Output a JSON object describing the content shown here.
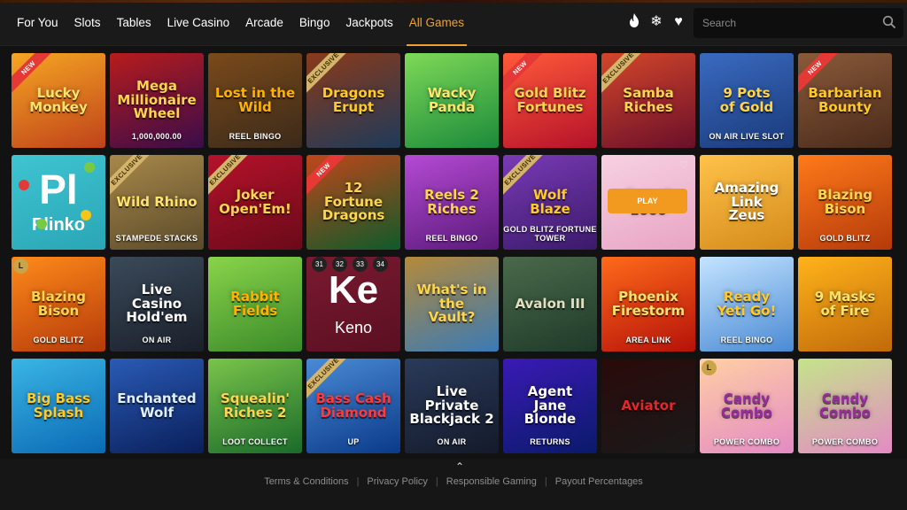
{
  "nav": {
    "items": [
      {
        "label": "For You"
      },
      {
        "label": "Slots"
      },
      {
        "label": "Tables"
      },
      {
        "label": "Live Casino"
      },
      {
        "label": "Arcade"
      },
      {
        "label": "Bingo"
      },
      {
        "label": "Jackpots"
      },
      {
        "label": "All Games",
        "active": true
      }
    ],
    "icons": [
      "fire-icon",
      "snowflake-icon",
      "heart-icon"
    ]
  },
  "search": {
    "placeholder": "Search",
    "value": ""
  },
  "colors": {
    "accent": "#f0a030",
    "background": "#121212",
    "new_badge": "#e53935",
    "exclusive_badge": "#d4b46a"
  },
  "games": [
    {
      "title": "Lucky\nMonkey",
      "badge": "NEW",
      "bg": "#c0421a",
      "bg2": "#f5a623",
      "fg": "#ffe36b"
    },
    {
      "title": "Mega\nMillionaire\nWheel",
      "sub": "1,000,000.00",
      "bg": "#3a0c4a",
      "bg2": "#b71c1c",
      "fg": "#ffd54f"
    },
    {
      "title": "Lost in the\nWild",
      "sub": "REEL BINGO",
      "bg": "#3b2a1a",
      "bg2": "#7a4a1a",
      "fg": "#ffb300"
    },
    {
      "title": "Dragons\nErupt",
      "badge": "EXCLUSIVE",
      "bg": "#1e3a5a",
      "bg2": "#8a3a1a",
      "fg": "#ffca28"
    },
    {
      "title": "Wacky\nPanda",
      "bg": "#1b8a3a",
      "bg2": "#7ed957",
      "fg": "#ffe66b"
    },
    {
      "title": "Gold Blitz\nFortunes",
      "badge": "NEW",
      "bg": "#b5122a",
      "bg2": "#ff5a3a",
      "fg": "#ffd54f"
    },
    {
      "title": "Samba\nRiches",
      "badge": "EXCLUSIVE",
      "bg": "#6a0f2a",
      "bg2": "#d4462a",
      "fg": "#ffd54f"
    },
    {
      "title": "9 Pots\nof Gold",
      "sub": "ON AIR LIVE SLOT",
      "bg": "#1a3a7a",
      "bg2": "#3a6ac0",
      "fg": "#ffd54f"
    },
    {
      "title": "Barbarian\nBounty",
      "badge": "NEW",
      "bg": "#4a2a1a",
      "bg2": "#8a5a3a",
      "fg": "#ffca28"
    },
    {
      "title": "",
      "kind": "plinko",
      "big": "Pl",
      "small": "Plinko",
      "bg": "#2aa6b5",
      "bg2": "#3fc4d2",
      "fg": "#ffffff"
    },
    {
      "title": "Wild Rhino",
      "sub": "STAMPEDE STACKS",
      "badge": "EXCLUSIVE",
      "bg": "#5a4a2a",
      "bg2": "#a8884a",
      "fg": "#ffe36b"
    },
    {
      "title": "Joker\nOpen'Em!",
      "badge": "EXCLUSIVE",
      "bg": "#6a0a1a",
      "bg2": "#b5122a",
      "fg": "#ffd54f"
    },
    {
      "title": "12\nFortune\nDragons",
      "badge": "NEW",
      "bg": "#0f5a2a",
      "bg2": "#c0461a",
      "fg": "#ffd54f"
    },
    {
      "title": "Reels 2\nRiches",
      "sub": "REEL BINGO",
      "bg": "#5a1a7a",
      "bg2": "#b54ad4",
      "fg": "#ffd54f"
    },
    {
      "title": "Wolf\nBlaze",
      "sub": "GOLD BLITZ FORTUNE TOWER",
      "badge": "EXCLUSIVE",
      "bg": "#3a1a6a",
      "bg2": "#7a3ab5",
      "fg": "#ffca28"
    },
    {
      "title": "Sweet\n1000",
      "kind": "play",
      "play": "PLAY",
      "bg": "#e8a4c4",
      "bg2": "#f7d1e2",
      "fg": "#ffe36b"
    },
    {
      "title": "Amazing Link\nZeus",
      "bg": "#d48a1a",
      "bg2": "#ffc24a",
      "fg": "#ffffff"
    },
    {
      "title": "Blazing\nBison",
      "sub": "GOLD BLITZ",
      "bg": "#b53a0a",
      "bg2": "#ff7a1a",
      "fg": "#ffd54f"
    },
    {
      "title": "Blazing\nBison",
      "sub": "GOLD BLITZ",
      "emblem": "L",
      "bg": "#b53a0a",
      "bg2": "#ff8a1a",
      "fg": "#ffd54f"
    },
    {
      "title": "Live Casino\nHold'em",
      "sub": "ON AIR",
      "bg": "#1a1f2a",
      "bg2": "#3a4a5a",
      "fg": "#ffffff"
    },
    {
      "title": "Rabbit\nFields",
      "bg": "#3a8a2a",
      "bg2": "#8ad44a",
      "fg": "#ffb300"
    },
    {
      "title": "",
      "kind": "keno",
      "big": "Ke",
      "small": "Keno",
      "numbers": [
        "31",
        "32",
        "33",
        "34"
      ],
      "bg": "#5a0f22",
      "bg2": "#7a1a30",
      "fg": "#ffffff"
    },
    {
      "title": "What's in the\nVault?",
      "bg": "#3a7ab5",
      "bg2": "#b58a3a",
      "fg": "#ffd54f"
    },
    {
      "title": "Avalon III",
      "bg": "#1f3a2a",
      "bg2": "#4a6a4a",
      "fg": "#e0e0c0"
    },
    {
      "title": "Phoenix\nFirestorm",
      "sub": "AREA LINK",
      "bg": "#b5120a",
      "bg2": "#ff6a1a",
      "fg": "#ffe36b"
    },
    {
      "title": "Ready\nYeti Go!",
      "sub": "REEL BINGO",
      "bg": "#4a8ad4",
      "bg2": "#c4e4ff",
      "fg": "#ffca28"
    },
    {
      "title": "9 Masks\nof Fire",
      "bg": "#c06a0a",
      "bg2": "#ffb31a",
      "fg": "#ffe36b"
    },
    {
      "title": "Big Bass\nSplash",
      "bg": "#0a6ab5",
      "bg2": "#3ab5e4",
      "fg": "#ffca28"
    },
    {
      "title": "Enchanted\nWolf",
      "bg": "#0a1f5a",
      "bg2": "#2a5ab5",
      "fg": "#e0f0ff"
    },
    {
      "title": "Squealin'\nRiches 2",
      "sub": "LOOT COLLECT",
      "bg": "#1a6a2a",
      "bg2": "#7ac44a",
      "fg": "#ffd54f"
    },
    {
      "title": "Bass Cash\nDiamond",
      "sub": "UP",
      "badge": "EXCLUSIVE",
      "bg": "#0a3a8a",
      "bg2": "#4a8ad4",
      "fg": "#ff3a3a"
    },
    {
      "title": "Live Private\nBlackjack 2",
      "sub": "ON AIR",
      "bg": "#141a2a",
      "bg2": "#2a3a5a",
      "fg": "#ffffff"
    },
    {
      "title": "Agent\nJane\nBlonde",
      "sub": "RETURNS",
      "bg": "#0a1a6a",
      "bg2": "#3a1ab5",
      "fg": "#ffffff"
    },
    {
      "title": "Aviator",
      "bg": "#1a1a1a",
      "bg2": "#2a0a0a",
      "fg": "#e5262a"
    },
    {
      "title": "Candy\nCombo",
      "sub": "POWER COMBO",
      "emblem": "L",
      "bg": "#e48ac4",
      "bg2": "#ffd0a4",
      "fg": "#9a2aa4"
    },
    {
      "title": "Candy\nCombo",
      "sub": "POWER COMBO",
      "bg": "#e48ac4",
      "bg2": "#c4e48a",
      "fg": "#9a2aa4"
    }
  ],
  "footer": {
    "links": [
      {
        "label": "Terms & Conditions"
      },
      {
        "label": "Privacy Policy"
      },
      {
        "label": "Responsible Gaming"
      },
      {
        "label": "Payout Percentages"
      }
    ]
  }
}
